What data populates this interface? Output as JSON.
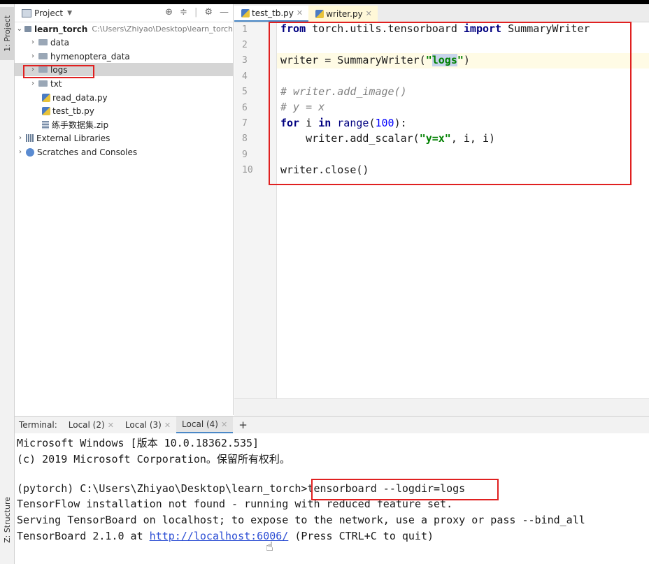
{
  "left_strip": {
    "project_tab": "1: Project",
    "structure_tab": "Z: Structure"
  },
  "project_panel": {
    "header": "Project",
    "tree": [
      {
        "label": "learn_torch",
        "path": "C:\\Users\\Zhiyao\\Desktop\\learn_torch",
        "expanded": true
      },
      {
        "label": "data"
      },
      {
        "label": "hymenoptera_data"
      },
      {
        "label": "logs",
        "selected": true
      },
      {
        "label": "txt"
      },
      {
        "label": "read_data.py"
      },
      {
        "label": "test_tb.py"
      },
      {
        "label": "练手数据集.zip"
      },
      {
        "label": "External Libraries"
      },
      {
        "label": "Scratches and Consoles"
      }
    ]
  },
  "editor": {
    "tabs": [
      {
        "label": "test_tb.py",
        "active": true
      },
      {
        "label": "writer.py",
        "active": false
      }
    ],
    "line_numbers": [
      "1",
      "2",
      "3",
      "4",
      "5",
      "6",
      "7",
      "8",
      "9",
      "10"
    ],
    "code": {
      "l1_kw1": "from",
      "l1_mid": " torch.utils.tensorboard ",
      "l1_kw2": "import",
      "l1_end": " SummaryWriter",
      "l3_a": "writer = SummaryWriter(",
      "l3_q1": "\"",
      "l3_hl": "logs",
      "l3_q2": "\"",
      "l3_end": ")",
      "l5": "# writer.add_image()",
      "l6": "# y = x",
      "l7_kw1": "for",
      "l7_a": " i ",
      "l7_kw2": "in",
      "l7_sp": " ",
      "l7_range": "range",
      "l7_p": "(",
      "l7_num": "100",
      "l7_end": "):",
      "l8_a": "    writer.add_scalar(",
      "l8_str": "\"y=x\"",
      "l8_end": ", i, i)",
      "l10": "writer.close()"
    }
  },
  "terminal": {
    "label": "Terminal:",
    "tabs": [
      {
        "label": "Local (2)"
      },
      {
        "label": "Local (3)"
      },
      {
        "label": "Local (4)",
        "active": true
      }
    ],
    "add": "+",
    "lines": {
      "l1": "Microsoft Windows [版本 10.0.18362.535]",
      "l2": "(c) 2019 Microsoft Corporation。保留所有权利。",
      "l3_prompt": "(pytorch) C:\\Users\\Zhiyao\\Desktop\\learn_torch>",
      "l3_cmd": "tensorboard --logdir=logs",
      "l4": "TensorFlow installation not found - running with reduced feature set.",
      "l5": "Serving TensorBoard on localhost; to expose to the network, use a proxy or pass --bind_all",
      "l6_a": "TensorBoard 2.1.0 at ",
      "l6_link": "http://localhost:6006/",
      "l6_b": " (Press CTRL+C to quit)"
    }
  }
}
